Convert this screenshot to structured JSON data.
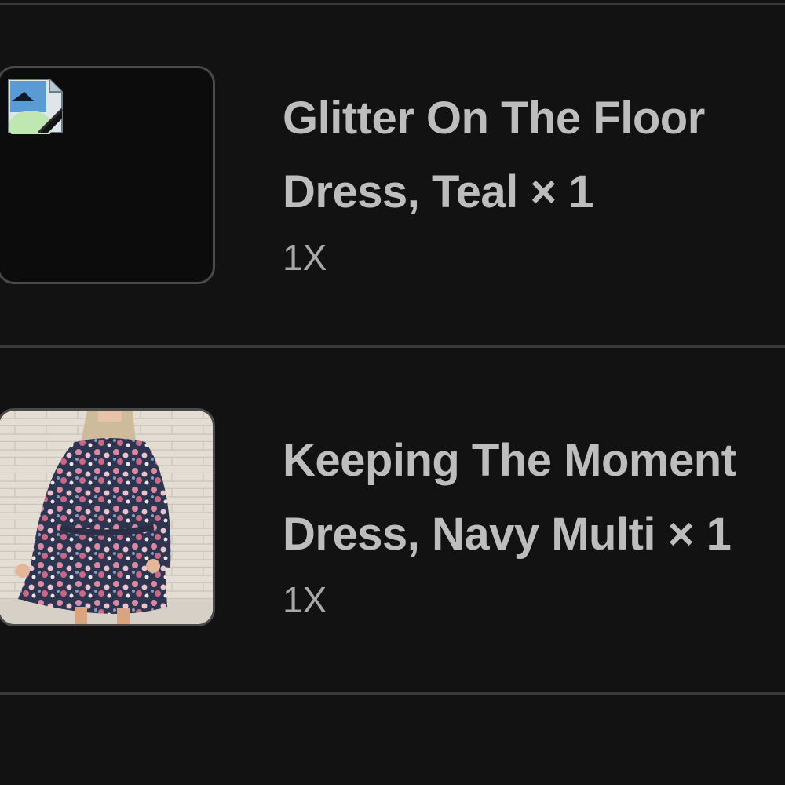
{
  "cart": {
    "items": [
      {
        "title_line1": "Glitter On The Floor",
        "title_line2": "Dress, Teal × 1",
        "size": "1X",
        "image": "broken-image-icon"
      },
      {
        "title_line1": "Keeping The Moment",
        "title_line2": "Dress, Navy Multi × 1",
        "size": "1X",
        "image": "floral-dress-photo"
      }
    ]
  },
  "colors": {
    "background": "#121212",
    "divider": "#3a3a3a",
    "title_text": "#bdbdbd",
    "variant_text": "#a8a8a8"
  }
}
